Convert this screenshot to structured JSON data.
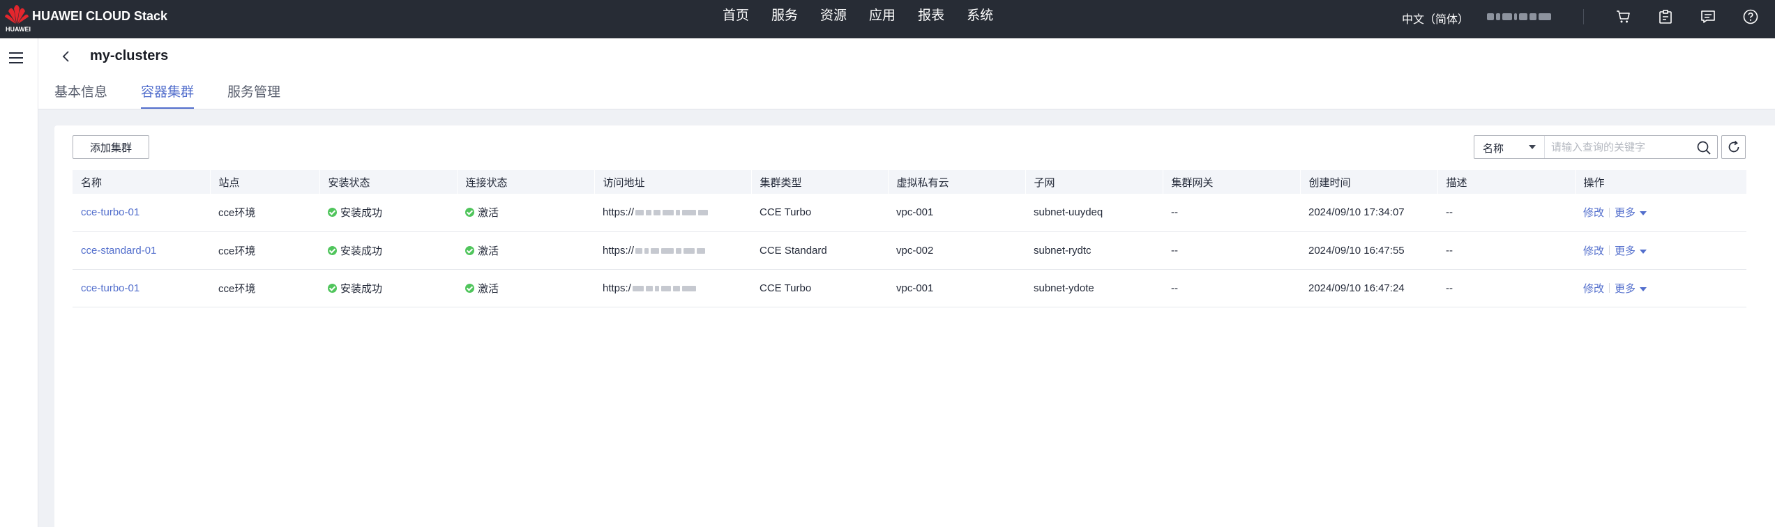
{
  "topbar": {
    "brand": "HUAWEI CLOUD Stack",
    "logo_small_text": "HUAWEI",
    "nav": [
      "首页",
      "服务",
      "资源",
      "应用",
      "报表",
      "系统"
    ],
    "language": "中文（简体）",
    "icons": [
      "cart-icon",
      "clipboard-icon",
      "message-icon",
      "help-icon"
    ]
  },
  "header": {
    "title": "my-clusters",
    "tabs": [
      {
        "label": "基本信息",
        "active": false
      },
      {
        "label": "容器集群",
        "active": true
      },
      {
        "label": "服务管理",
        "active": false
      }
    ]
  },
  "toolbar": {
    "add_label": "添加集群",
    "search_field": "名称",
    "search_placeholder": "请输入查询的关键字"
  },
  "table": {
    "columns": [
      "名称",
      "站点",
      "安装状态",
      "连接状态",
      "访问地址",
      "集群类型",
      "虚拟私有云",
      "子网",
      "集群网关",
      "创建时间",
      "描述",
      "操作"
    ],
    "rows": [
      {
        "name": "cce-turbo-01",
        "site": "cce环境",
        "install": "安装成功",
        "connect": "激活",
        "address": "https://",
        "type": "CCE Turbo",
        "vpc": "vpc-001",
        "subnet": "subnet-uuydeq",
        "gateway": "--",
        "created": "2024/09/10 17:34:07",
        "desc": "--",
        "edit": "修改",
        "more": "更多"
      },
      {
        "name": "cce-standard-01",
        "site": "cce环境",
        "install": "安装成功",
        "connect": "激活",
        "address": "https://",
        "type": "CCE Standard",
        "vpc": "vpc-002",
        "subnet": "subnet-rydtc",
        "gateway": "--",
        "created": "2024/09/10 16:47:55",
        "desc": "--",
        "edit": "修改",
        "more": "更多"
      },
      {
        "name": "cce-turbo-01",
        "site": "cce环境",
        "install": "安装成功",
        "connect": "激活",
        "address": "https:/",
        "type": "CCE Turbo",
        "vpc": "vpc-001",
        "subnet": "subnet-ydote",
        "gateway": "--",
        "created": "2024/09/10 16:47:24",
        "desc": "--",
        "edit": "修改",
        "more": "更多"
      }
    ]
  },
  "colors": {
    "topbar_bg": "#272c35",
    "accent": "#526ecc",
    "success": "#50c55c",
    "page_bg": "#eff1f5"
  }
}
